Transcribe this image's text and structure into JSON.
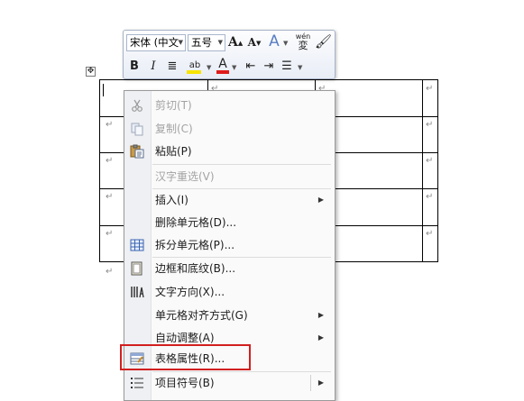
{
  "toolbar": {
    "font_name": "宋体 (中文",
    "font_size": "五号",
    "grow_font": "A",
    "shrink_font": "A",
    "text_effect": "A",
    "phonetic_top": "wén",
    "phonetic_bottom": "変",
    "bold": "B",
    "italic": "I",
    "highlight": "ab",
    "font_color": "A",
    "highlight_color": "#f7e400",
    "font_color_value": "#e01b1b"
  },
  "document": {
    "cell_marker": "↵",
    "table_move_handle": "✥"
  },
  "context_menu": {
    "items": [
      {
        "label": "剪切(T)",
        "icon": "scissors-icon",
        "disabled": true
      },
      {
        "label": "复制(C)",
        "icon": "copy-icon",
        "disabled": true
      },
      {
        "label": "粘贴(P)",
        "icon": "paste-icon",
        "disabled": false
      },
      {
        "label": "汉字重选(V)",
        "icon": "",
        "disabled": true
      },
      {
        "label": "插入(I)",
        "icon": "",
        "disabled": false,
        "submenu": true
      },
      {
        "label": "删除单元格(D)...",
        "icon": "",
        "disabled": false
      },
      {
        "label": "拆分单元格(P)...",
        "icon": "split-cells-icon",
        "disabled": false
      },
      {
        "label": "边框和底纹(B)...",
        "icon": "borders-shading-icon",
        "disabled": false
      },
      {
        "label": "文字方向(X)...",
        "icon": "text-direction-icon",
        "disabled": false
      },
      {
        "label": "单元格对齐方式(G)",
        "icon": "",
        "disabled": false,
        "submenu": true
      },
      {
        "label": "自动调整(A)",
        "icon": "",
        "disabled": false,
        "submenu": true
      },
      {
        "label": "表格属性(R)...",
        "icon": "table-properties-icon",
        "disabled": false
      },
      {
        "label": "项目符号(B)",
        "icon": "bullets-icon",
        "disabled": false,
        "submenu": true
      }
    ],
    "submenu_arrow": "▶",
    "highlight_color": "#d21f1f"
  }
}
